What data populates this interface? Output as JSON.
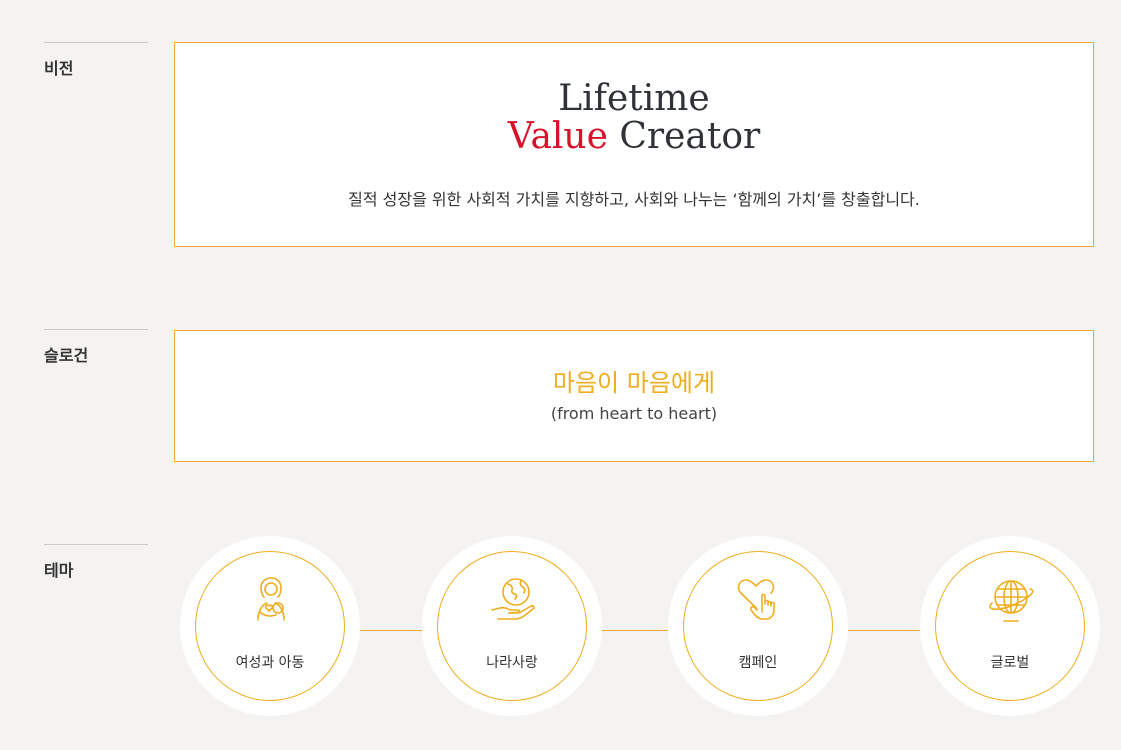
{
  "sections": {
    "vision_label": "비전",
    "slogan_label": "슬로건",
    "theme_label": "테마"
  },
  "vision": {
    "title_line1": "Lifetime",
    "title_accent": "Value",
    "title_rest": " Creator",
    "description": "질적 성장을 위한 사회적 가치를 지향하고, 사회와 나누는 ‘함께의 가치’를 창출합니다."
  },
  "slogan": {
    "main": "마음이 마음에게",
    "sub": "(from heart to heart)"
  },
  "themes": [
    {
      "label": "여성과 아동",
      "icon": "mother-child-icon"
    },
    {
      "label": "나라사랑",
      "icon": "globe-hand-icon"
    },
    {
      "label": "캠페인",
      "icon": "heart-hand-icon"
    },
    {
      "label": "글로벌",
      "icon": "globe-orbit-icon"
    }
  ],
  "colors": {
    "accent_orange": "#efad1f",
    "accent_red": "#d8102a",
    "border": "#f0a83a"
  }
}
